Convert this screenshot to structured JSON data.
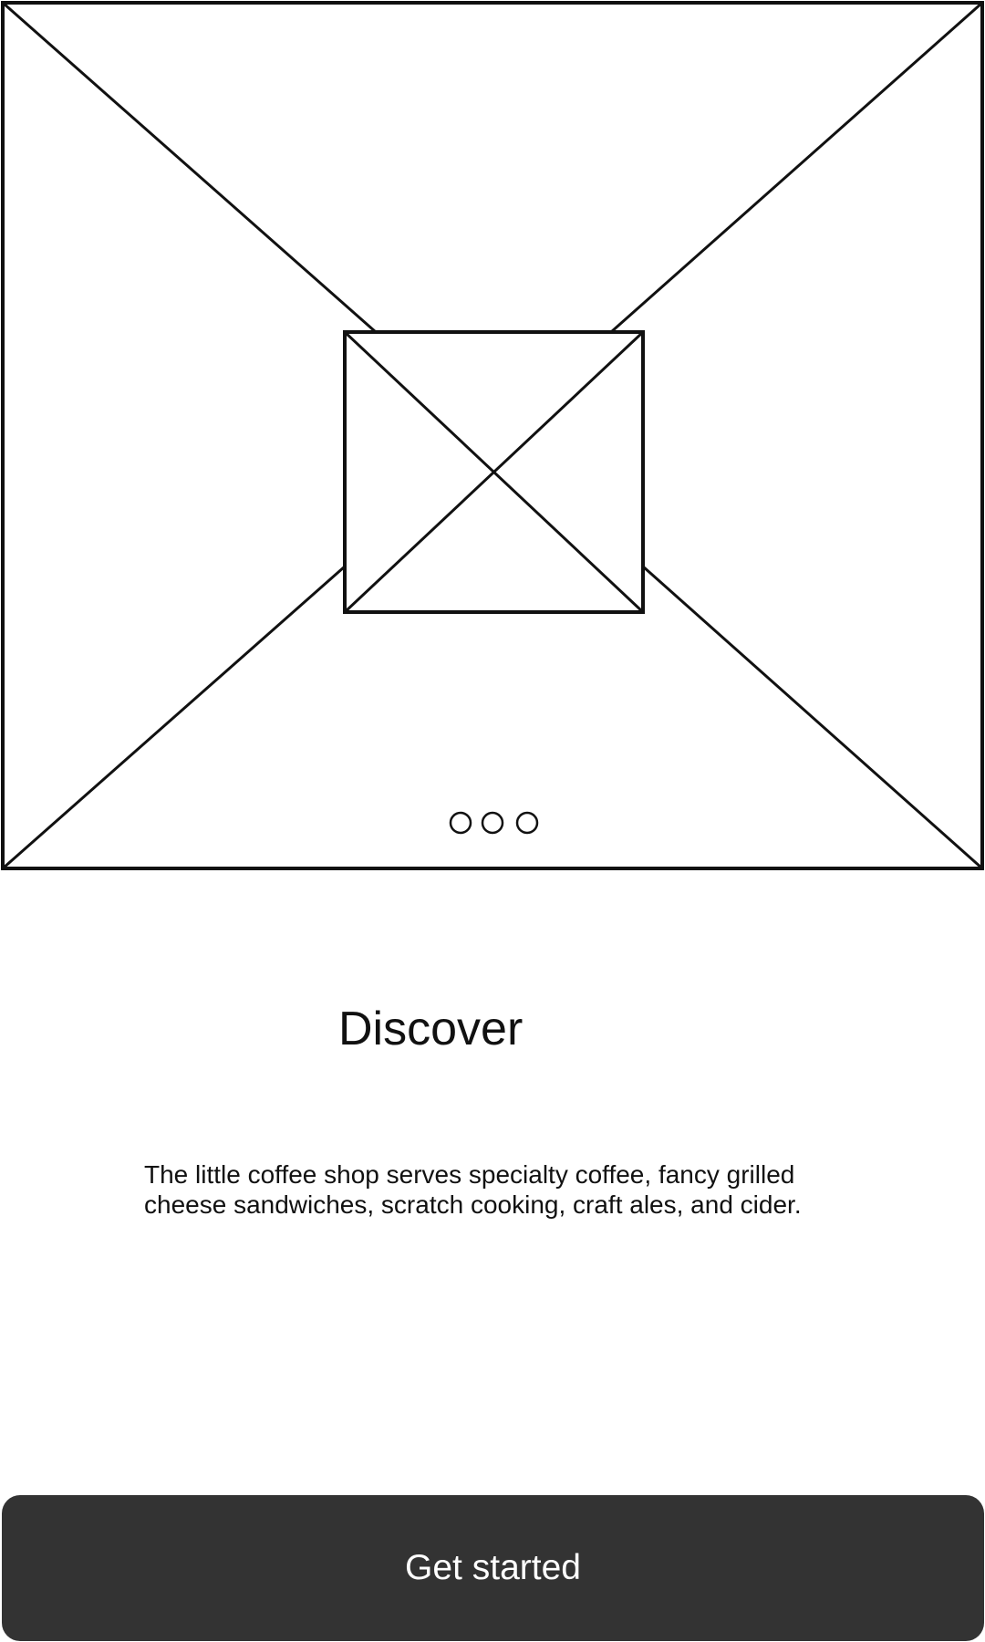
{
  "hero": {
    "image_placeholder_icon": "image-placeholder",
    "carousel": {
      "page_count": 3,
      "active_index": null
    }
  },
  "content": {
    "title": "Discover",
    "description": "The little coffee shop serves specialty coffee, fancy grilled cheese sandwiches, scratch cooking, craft ales, and cider."
  },
  "actions": {
    "get_started_label": "Get started"
  },
  "colors": {
    "button_background": "#333333",
    "button_text": "#ffffff",
    "background": "#ffffff",
    "stroke": "#111111"
  }
}
